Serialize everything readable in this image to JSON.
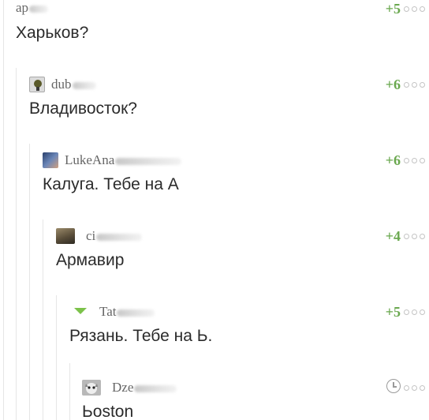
{
  "comments": [
    {
      "username": "ap",
      "rating": "+5",
      "text": "Харьков?",
      "avatar_icon": "none",
      "has_timer": false
    },
    {
      "username": "dub",
      "rating": "+6",
      "text": "Владивосток?",
      "avatar_icon": "lightbulb-avatar",
      "has_timer": false
    },
    {
      "username": "LukeAna",
      "rating": "+6",
      "text": "Калуга. Тебе на А",
      "avatar_icon": "photo-avatar",
      "has_timer": false
    },
    {
      "username": "ci",
      "rating": "+4",
      "text": "Армавир",
      "avatar_icon": "photo-avatar",
      "has_timer": false
    },
    {
      "username": "Tat",
      "rating": "+5",
      "text": "Рязань. Тебе на Ь.",
      "avatar_icon": "green-triangle-icon",
      "has_timer": false
    },
    {
      "username": "Dze",
      "rating": "",
      "text": "Ьoston",
      "avatar_icon": "cat-avatar",
      "has_timer": true
    }
  ],
  "colors": {
    "rating_green": "#6aa84f",
    "guide_line": "#e6e6e6",
    "username_gray": "#666666"
  }
}
